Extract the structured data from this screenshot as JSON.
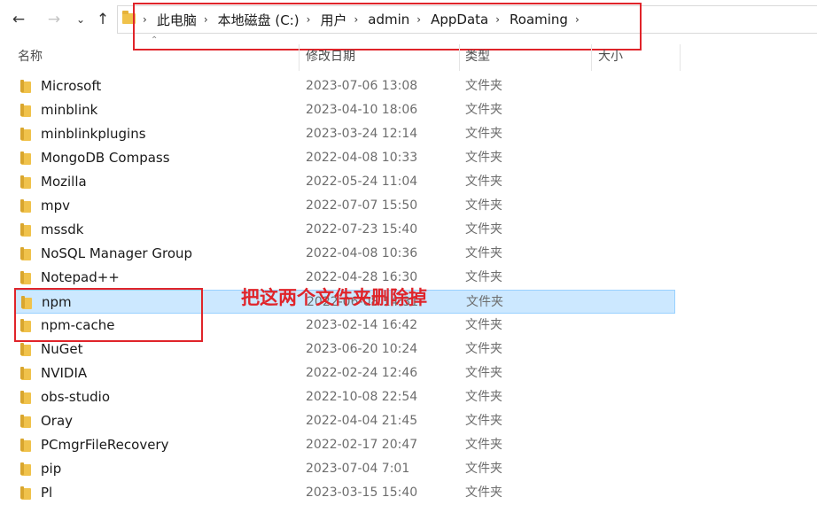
{
  "nav": {
    "back_icon": "arrow-left-icon",
    "forward_icon": "arrow-right-icon",
    "recent_icon": "chevron-down-icon",
    "up_icon": "arrow-up-icon"
  },
  "breadcrumb": [
    "此电脑",
    "本地磁盘 (C:)",
    "用户",
    "admin",
    "AppData",
    "Roaming"
  ],
  "columns": {
    "name": "名称",
    "date": "修改日期",
    "type": "类型",
    "size": "大小"
  },
  "files": [
    {
      "name": "Microsoft",
      "date": "2023-07-06 13:08",
      "type": "文件夹"
    },
    {
      "name": "minblink",
      "date": "2023-04-10 18:06",
      "type": "文件夹"
    },
    {
      "name": "minblinkplugins",
      "date": "2023-03-24 12:14",
      "type": "文件夹"
    },
    {
      "name": "MongoDB Compass",
      "date": "2022-04-08 10:33",
      "type": "文件夹"
    },
    {
      "name": "Mozilla",
      "date": "2022-05-24 11:04",
      "type": "文件夹"
    },
    {
      "name": "mpv",
      "date": "2022-07-07 15:50",
      "type": "文件夹"
    },
    {
      "name": "mssdk",
      "date": "2022-07-23 15:40",
      "type": "文件夹"
    },
    {
      "name": "NoSQL Manager Group",
      "date": "2022-04-08 10:36",
      "type": "文件夹"
    },
    {
      "name": "Notepad++",
      "date": "2022-04-28 16:30",
      "type": "文件夹"
    },
    {
      "name": "npm",
      "date": "2022-06-08 14:31",
      "type": "文件夹",
      "selected": true
    },
    {
      "name": "npm-cache",
      "date": "2023-02-14 16:42",
      "type": "文件夹"
    },
    {
      "name": "NuGet",
      "date": "2023-06-20 10:24",
      "type": "文件夹"
    },
    {
      "name": "NVIDIA",
      "date": "2022-02-24 12:46",
      "type": "文件夹"
    },
    {
      "name": "obs-studio",
      "date": "2022-10-08 22:54",
      "type": "文件夹"
    },
    {
      "name": "Oray",
      "date": "2022-04-04 21:45",
      "type": "文件夹"
    },
    {
      "name": "PCmgrFileRecovery",
      "date": "2022-02-17 20:47",
      "type": "文件夹"
    },
    {
      "name": "pip",
      "date": "2023-07-04 7:01",
      "type": "文件夹"
    },
    {
      "name": "Pl",
      "date": "2023-03-15 15:40",
      "type": "文件夹"
    }
  ],
  "annotation": "把这两个文件夹删除掉",
  "colors": {
    "highlight_box": "#e0242a",
    "selection": "#cce8ff",
    "folder": "#f0c24b"
  }
}
